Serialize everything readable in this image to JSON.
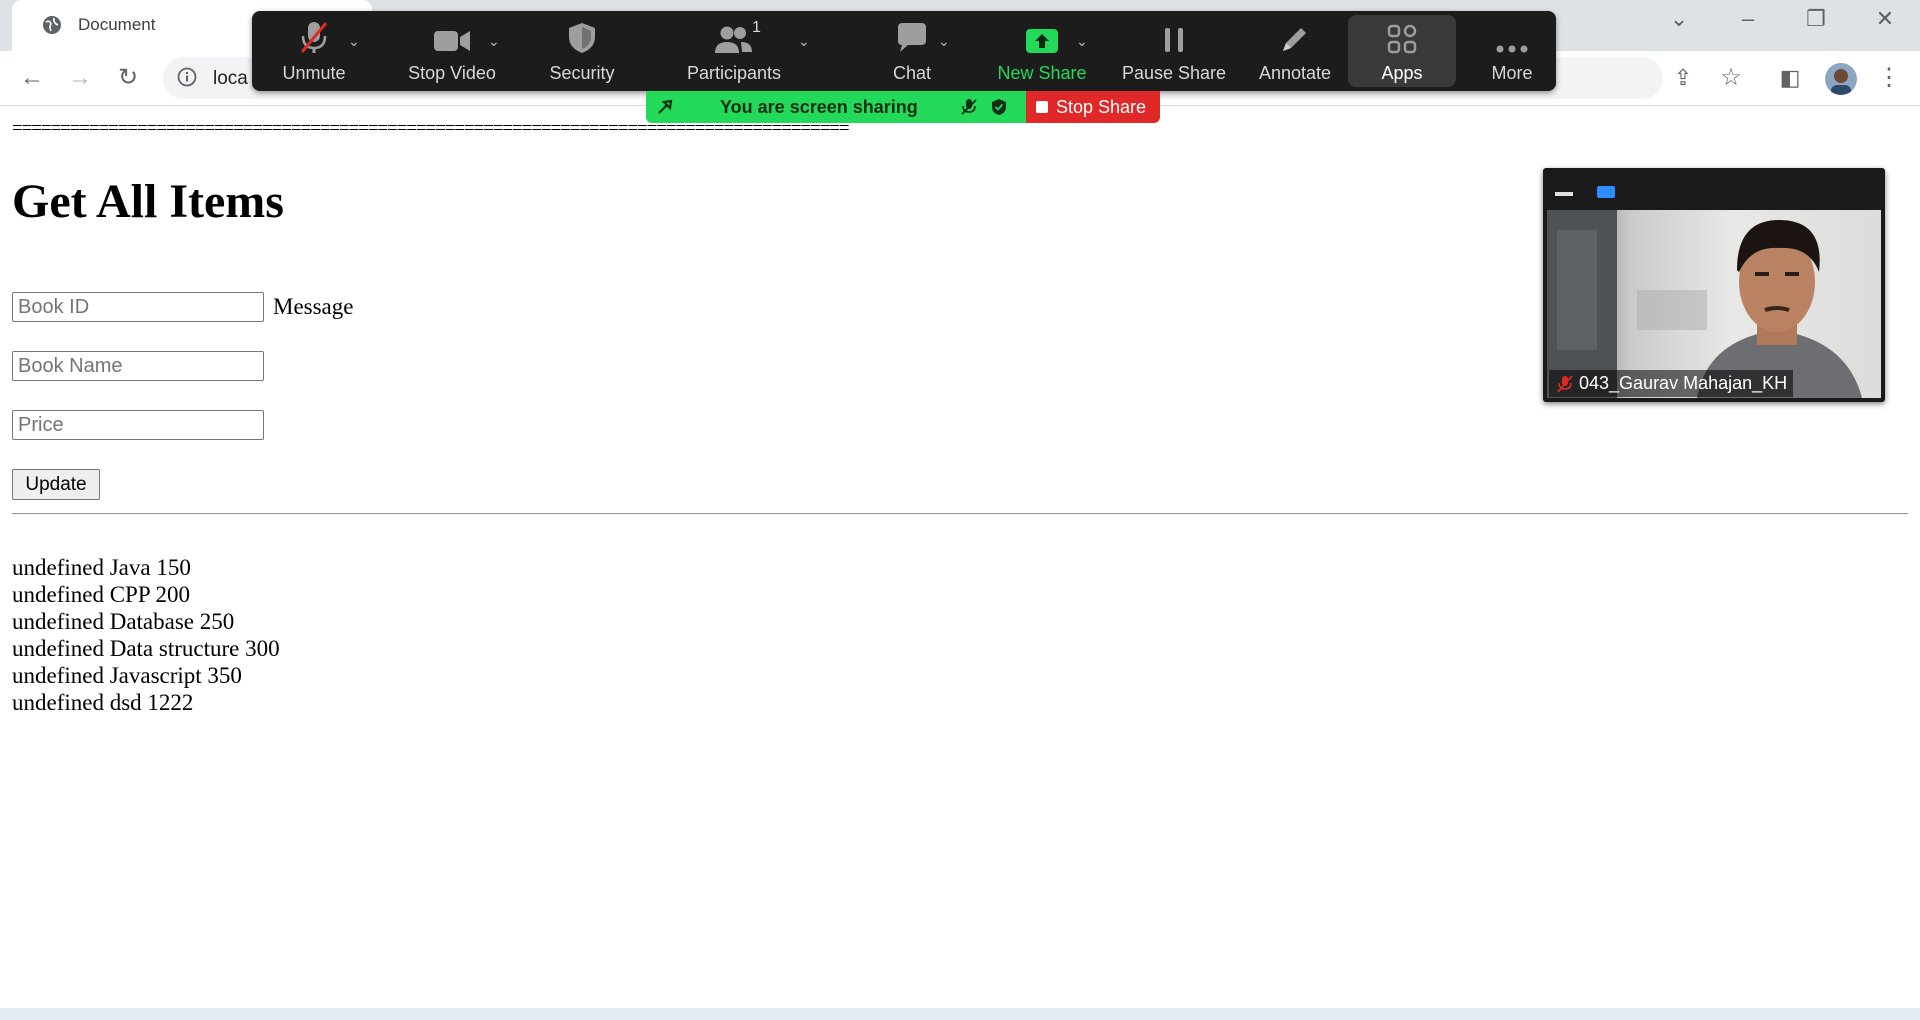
{
  "browser": {
    "tab_title": "Document",
    "url": "loca"
  },
  "page": {
    "separator": "=======================================================================================",
    "heading": "Get All Items",
    "fields": [
      {
        "placeholder": "Book ID"
      },
      {
        "placeholder": "Book Name"
      },
      {
        "placeholder": "Price"
      }
    ],
    "message_label": "Message",
    "update_label": "Update",
    "items": [
      "undefined Java 150",
      "undefined CPP 200",
      "undefined Database 250",
      "undefined Data structure 300",
      "undefined Javascript 350",
      "undefined dsd 1222"
    ]
  },
  "zoom": {
    "buttons": {
      "unmute": "Unmute",
      "stop_video": "Stop Video",
      "security": "Security",
      "participants": "Participants",
      "participants_count": "1",
      "chat": "Chat",
      "new_share": "New Share",
      "pause_share": "Pause Share",
      "annotate": "Annotate",
      "apps": "Apps",
      "more": "More"
    },
    "share_status": "You are screen sharing",
    "stop_share": "Stop Share",
    "video_participant": "043_Gaurav Mahajan_KH",
    "colors": {
      "green": "#23d959",
      "red": "#e02828",
      "toolbar": "#1c1c1c"
    }
  }
}
